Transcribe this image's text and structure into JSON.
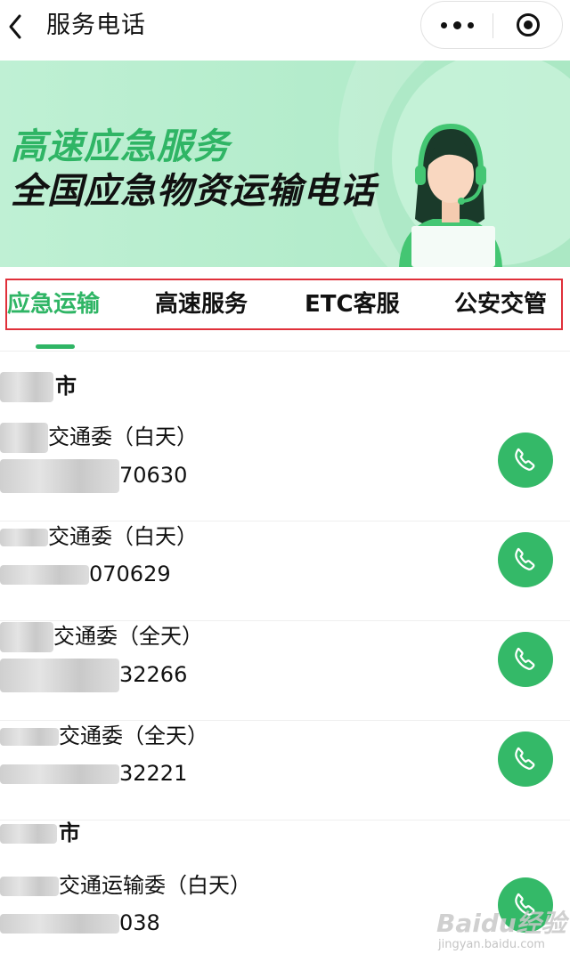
{
  "header": {
    "title": "服务电话"
  },
  "banner": {
    "line1": "高速应急服务",
    "line2": "全国应急物资运输电话"
  },
  "tabs": [
    {
      "label": "应急运输",
      "active": true
    },
    {
      "label": "高速服务",
      "active": false
    },
    {
      "label": "ETC客服",
      "active": false
    },
    {
      "label": "公安交管",
      "active": false
    }
  ],
  "groups": [
    {
      "city": "市",
      "items": [
        {
          "name": "交通委（白天）",
          "phone": "70630"
        },
        {
          "name": "交通委（白天）",
          "phone": "070629"
        },
        {
          "name": "交通委（全天）",
          "phone": "32266"
        },
        {
          "name": "交通委（全天）",
          "phone": "32221"
        }
      ]
    },
    {
      "city": "市",
      "items": [
        {
          "name": "交通运输委（白天）",
          "phone": "038"
        }
      ]
    }
  ],
  "watermark": {
    "text": "Baidu经验",
    "sub": "jingyan.baidu.com"
  },
  "colors": {
    "accent": "#2fb565",
    "call_button": "#34b968",
    "highlight_border": "#e0303a"
  }
}
